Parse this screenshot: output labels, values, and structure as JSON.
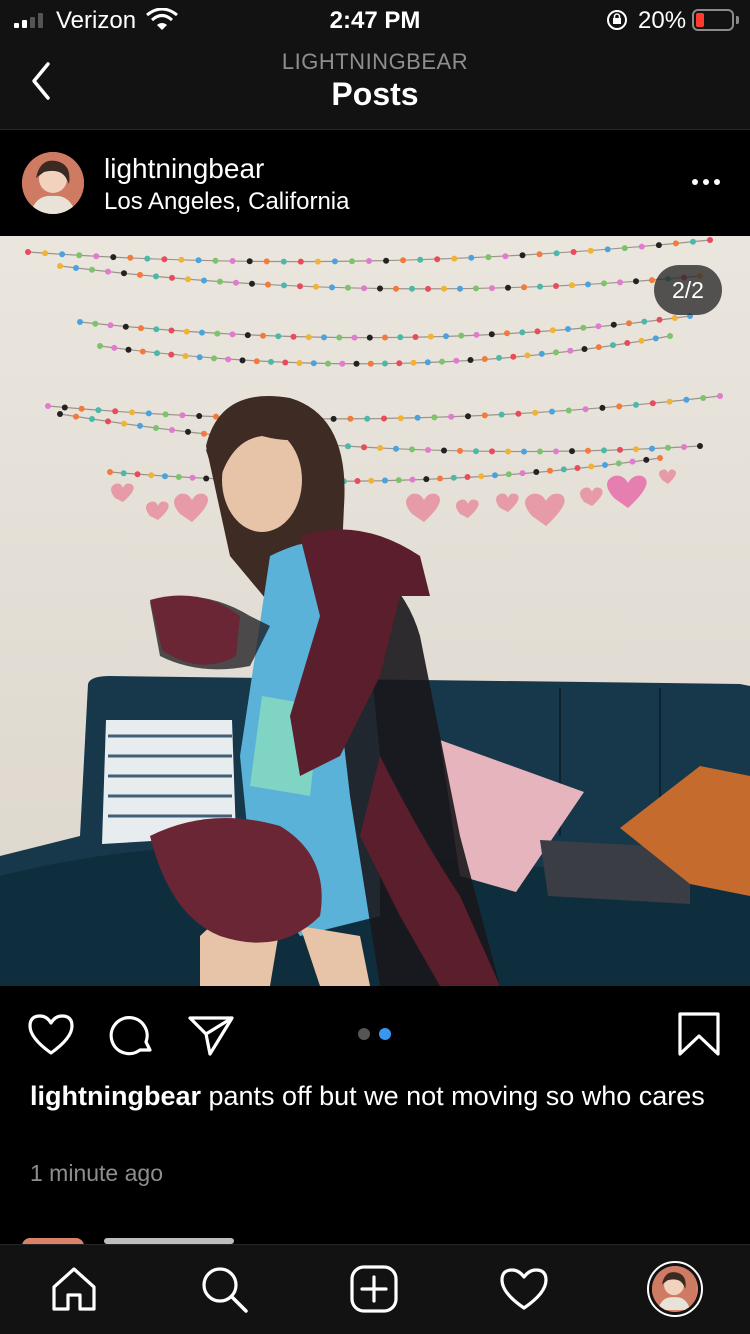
{
  "status_bar": {
    "carrier": "Verizon",
    "time": "2:47 PM",
    "battery_percent": "20%",
    "battery_level": 0.2,
    "battery_color": "#ff3b30"
  },
  "header": {
    "subtitle": "LIGHTNINGBEAR",
    "title": "Posts",
    "back_icon": "chevron-left-icon"
  },
  "post": {
    "username": "lightningbear",
    "location": "Los Angeles, California",
    "more_icon": "more-horizontal-icon",
    "image_counter": "2/2",
    "carousel": {
      "total": 2,
      "active_index": 1,
      "active_color": "#3897f0",
      "inactive_color": "#555555"
    },
    "actions": [
      "heart-icon",
      "comment-icon",
      "share-icon",
      "bookmark-icon"
    ],
    "caption_username": "lightningbear",
    "caption_text": " pants off but we not moving so who cares",
    "timestamp": "1 minute ago"
  },
  "tab_bar": {
    "items": [
      "home-icon",
      "search-icon",
      "new-post-icon",
      "activity-icon",
      "profile-avatar"
    ]
  }
}
